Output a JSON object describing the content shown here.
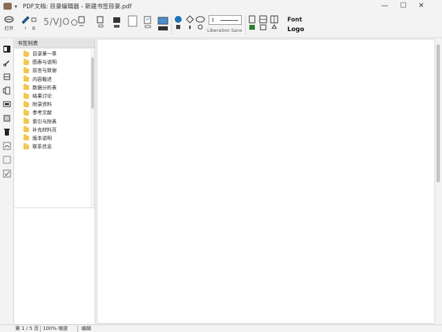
{
  "titlebar": {
    "dropdown": "▾",
    "title": "PDF文档: 目录编辑器 - 新建书签目录.pdf",
    "min": "—",
    "max": "☐",
    "close": "✕"
  },
  "ribbon": {
    "btn1_label": "打开",
    "btn2_label": "I",
    "btn3_label": "B",
    "page_indicator": "5/VJO",
    "font_size_value": "1",
    "font_name": "Liberation Sans",
    "logo_line1": "Font",
    "logo_line2": "Logo"
  },
  "sidebar": {
    "header": "书签列表",
    "items": [
      {
        "label": "目录第一章"
      },
      {
        "label": "图表与说明"
      },
      {
        "label": "前言与致谢"
      },
      {
        "label": "内容概述"
      },
      {
        "label": "数据分析表"
      },
      {
        "label": "结果讨论"
      },
      {
        "label": "附录资料"
      },
      {
        "label": "参考文献"
      },
      {
        "label": "索引与附表"
      },
      {
        "label": "补充材料页"
      },
      {
        "label": "版本说明"
      },
      {
        "label": "联系信息"
      }
    ]
  },
  "statusbar": {
    "page": "第 1 / 5 页",
    "zoom": "100% 缩放",
    "mode": "编辑"
  },
  "colors": {
    "folder": "#f3c64e",
    "accent_blue": "#1e73be",
    "app_icon": "#8b6a55"
  }
}
